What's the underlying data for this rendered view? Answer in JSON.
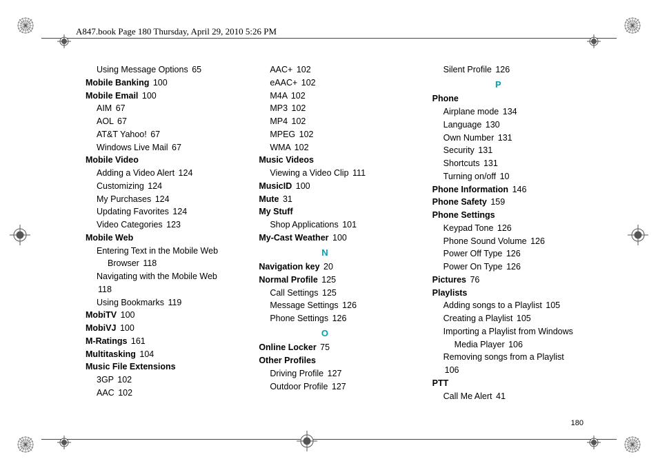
{
  "header": "A847.book  Page 180  Thursday, April 29, 2010  5:26 PM",
  "page_number": "180",
  "columns": [
    [
      {
        "lvl": 2,
        "term": "Using Message Options",
        "pg": "65"
      },
      {
        "lvl": 1,
        "bold": true,
        "term": "Mobile Banking",
        "pg": "100"
      },
      {
        "lvl": 1,
        "bold": true,
        "term": "Mobile Email",
        "pg": "100"
      },
      {
        "lvl": 2,
        "term": "AIM",
        "pg": "67"
      },
      {
        "lvl": 2,
        "term": "AOL",
        "pg": "67"
      },
      {
        "lvl": 2,
        "term": "AT&T Yahoo!",
        "pg": "67"
      },
      {
        "lvl": 2,
        "term": "Windows Live Mail",
        "pg": "67"
      },
      {
        "lvl": 1,
        "bold": true,
        "term": "Mobile Video"
      },
      {
        "lvl": 2,
        "term": "Adding a Video Alert",
        "pg": "124"
      },
      {
        "lvl": 2,
        "term": "Customizing",
        "pg": "124"
      },
      {
        "lvl": 2,
        "term": "My Purchases",
        "pg": "124"
      },
      {
        "lvl": 2,
        "term": "Updating Favorites",
        "pg": "124"
      },
      {
        "lvl": 2,
        "term": "Video Categories",
        "pg": "123"
      },
      {
        "lvl": 1,
        "bold": true,
        "term": "Mobile Web"
      },
      {
        "lvl": 2,
        "term": "Entering Text in the Mobile Web"
      },
      {
        "lvl": 3,
        "term": "Browser",
        "pg": "118"
      },
      {
        "lvl": 2,
        "term": "Navigating with the Mobile Web",
        "pg": "118"
      },
      {
        "lvl": 2,
        "term": "Using Bookmarks",
        "pg": "119"
      },
      {
        "lvl": 1,
        "bold": true,
        "term": "MobiTV",
        "pg": "100"
      },
      {
        "lvl": 1,
        "bold": true,
        "term": "MobiVJ",
        "pg": "100"
      },
      {
        "lvl": 1,
        "bold": true,
        "term": "M-Ratings",
        "pg": "161"
      },
      {
        "lvl": 1,
        "bold": true,
        "term": "Multitasking",
        "pg": "104"
      },
      {
        "lvl": 1,
        "bold": true,
        "term": "Music File Extensions"
      },
      {
        "lvl": 2,
        "term": "3GP",
        "pg": "102"
      },
      {
        "lvl": 2,
        "term": "AAC",
        "pg": "102"
      }
    ],
    [
      {
        "lvl": 2,
        "term": "AAC+",
        "pg": "102"
      },
      {
        "lvl": 2,
        "term": "eAAC+",
        "pg": "102"
      },
      {
        "lvl": 2,
        "term": "M4A",
        "pg": "102"
      },
      {
        "lvl": 2,
        "term": "MP3",
        "pg": "102"
      },
      {
        "lvl": 2,
        "term": "MP4",
        "pg": "102"
      },
      {
        "lvl": 2,
        "term": "MPEG",
        "pg": "102"
      },
      {
        "lvl": 2,
        "term": "WMA",
        "pg": "102"
      },
      {
        "lvl": 1,
        "bold": true,
        "term": "Music Videos"
      },
      {
        "lvl": 2,
        "term": "Viewing a Video Clip",
        "pg": "111"
      },
      {
        "lvl": 1,
        "bold": true,
        "term": "MusicID",
        "pg": "100"
      },
      {
        "lvl": 1,
        "bold": true,
        "term": "Mute",
        "pg": "31"
      },
      {
        "lvl": 1,
        "bold": true,
        "term": "My Stuff"
      },
      {
        "lvl": 2,
        "term": "Shop Applications",
        "pg": "101"
      },
      {
        "lvl": 1,
        "bold": true,
        "term": "My-Cast Weather",
        "pg": "100"
      },
      {
        "section": "N"
      },
      {
        "lvl": 1,
        "bold": true,
        "term": "Navigation key",
        "pg": "20"
      },
      {
        "lvl": 1,
        "bold": true,
        "term": "Normal Profile",
        "pg": "125"
      },
      {
        "lvl": 2,
        "term": "Call Settings",
        "pg": "125"
      },
      {
        "lvl": 2,
        "term": "Message Settings",
        "pg": "126"
      },
      {
        "lvl": 2,
        "term": "Phone Settings",
        "pg": "126"
      },
      {
        "section": "O"
      },
      {
        "lvl": 1,
        "bold": true,
        "term": "Online Locker",
        "pg": "75"
      },
      {
        "lvl": 1,
        "bold": true,
        "term": "Other Profiles"
      },
      {
        "lvl": 2,
        "term": "Driving Profile",
        "pg": "127"
      },
      {
        "lvl": 2,
        "term": "Outdoor Profile",
        "pg": "127"
      }
    ],
    [
      {
        "lvl": 2,
        "term": "Silent Profile",
        "pg": "126"
      },
      {
        "section": "P"
      },
      {
        "lvl": 1,
        "bold": true,
        "term": "Phone"
      },
      {
        "lvl": 2,
        "term": "Airplane mode",
        "pg": "134"
      },
      {
        "lvl": 2,
        "term": "Language",
        "pg": "130"
      },
      {
        "lvl": 2,
        "term": "Own Number",
        "pg": "131"
      },
      {
        "lvl": 2,
        "term": "Security",
        "pg": "131"
      },
      {
        "lvl": 2,
        "term": "Shortcuts",
        "pg": "131"
      },
      {
        "lvl": 2,
        "term": "Turning on/off",
        "pg": "10"
      },
      {
        "lvl": 1,
        "bold": true,
        "term": "Phone Information",
        "pg": "146"
      },
      {
        "lvl": 1,
        "bold": true,
        "term": "Phone Safety",
        "pg": "159"
      },
      {
        "lvl": 1,
        "bold": true,
        "term": "Phone Settings"
      },
      {
        "lvl": 2,
        "term": "Keypad Tone",
        "pg": "126"
      },
      {
        "lvl": 2,
        "term": "Phone Sound Volume",
        "pg": "126"
      },
      {
        "lvl": 2,
        "term": "Power Off Type",
        "pg": "126"
      },
      {
        "lvl": 2,
        "term": "Power On Type",
        "pg": "126"
      },
      {
        "lvl": 1,
        "bold": true,
        "term": "Pictures",
        "pg": "76"
      },
      {
        "lvl": 1,
        "bold": true,
        "term": "Playlists"
      },
      {
        "lvl": 2,
        "term": "Adding songs to a Playlist",
        "pg": "105"
      },
      {
        "lvl": 2,
        "term": "Creating a Playlist",
        "pg": "105"
      },
      {
        "lvl": 2,
        "term": "Importing a Playlist from Windows"
      },
      {
        "lvl": 3,
        "term": "Media Player",
        "pg": "106"
      },
      {
        "lvl": 2,
        "term": "Removing songs from a Playlist",
        "pg": "106"
      },
      {
        "lvl": 1,
        "bold": true,
        "term": "PTT"
      },
      {
        "lvl": 2,
        "term": "Call Me Alert",
        "pg": "41"
      }
    ]
  ]
}
